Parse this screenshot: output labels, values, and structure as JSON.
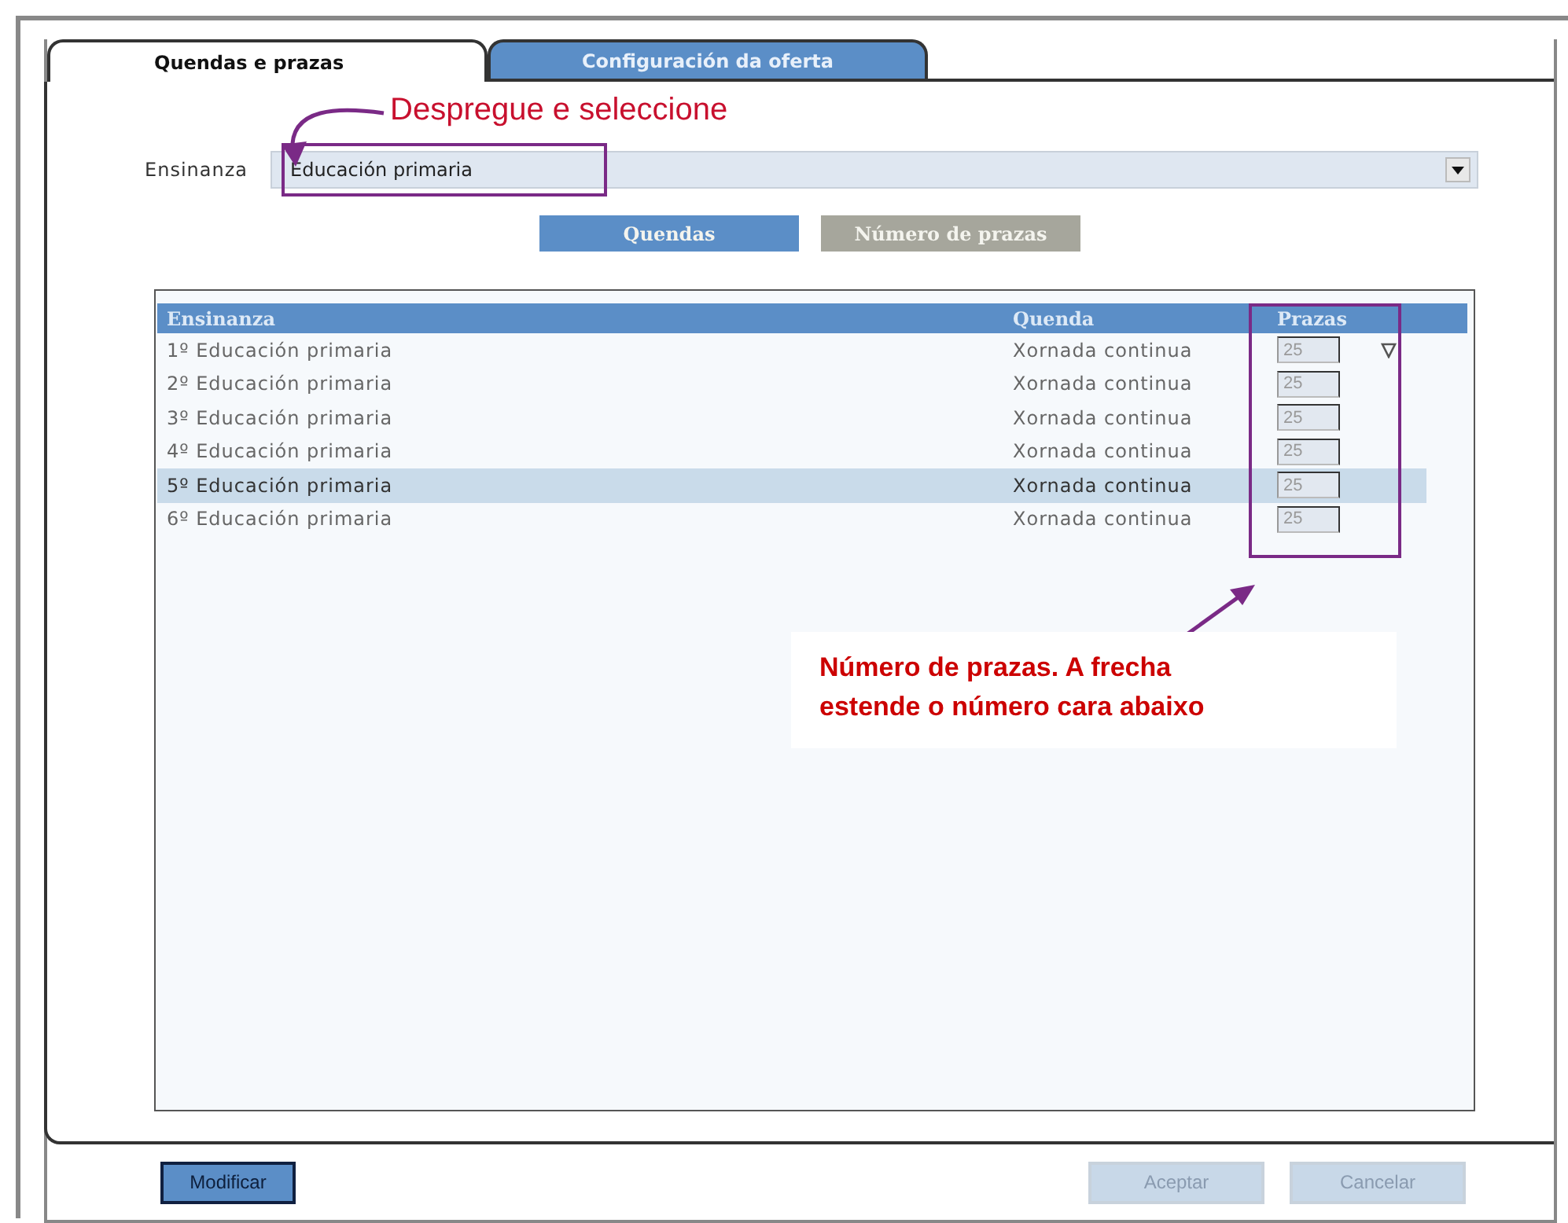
{
  "tabs": [
    {
      "label": "Quendas e prazas",
      "selected": true
    },
    {
      "label": "Configuración da oferta",
      "selected": false
    }
  ],
  "ensinanza": {
    "label": "Ensinanza",
    "value": "Educación primaria"
  },
  "view_buttons": [
    {
      "label": "Quendas",
      "selected": true
    },
    {
      "label": "Número de prazas",
      "selected": false
    }
  ],
  "table": {
    "columns": [
      "Ensinanza",
      "Quenda",
      "Prazas"
    ],
    "rows": [
      {
        "ensinanza": "1º Educación primaria",
        "quenda": "Xornada continua",
        "prazas": "25",
        "selected": false,
        "fill_down": true
      },
      {
        "ensinanza": "2º Educación primaria",
        "quenda": "Xornada continua",
        "prazas": "25",
        "selected": false,
        "fill_down": false
      },
      {
        "ensinanza": "3º Educación primaria",
        "quenda": "Xornada continua",
        "prazas": "25",
        "selected": false,
        "fill_down": false
      },
      {
        "ensinanza": "4º Educación primaria",
        "quenda": "Xornada continua",
        "prazas": "25",
        "selected": false,
        "fill_down": false
      },
      {
        "ensinanza": "5º Educación primaria",
        "quenda": "Xornada continua",
        "prazas": "25",
        "selected": true,
        "fill_down": false
      },
      {
        "ensinanza": "6º Educación primaria",
        "quenda": "Xornada continua",
        "prazas": "25",
        "selected": false,
        "fill_down": false
      }
    ]
  },
  "buttons": [
    {
      "label": "Modificar",
      "disabled": false
    },
    {
      "label": "Aceptar",
      "disabled": true
    },
    {
      "label": "Cancelar",
      "disabled": true
    }
  ],
  "annotations": {
    "select_hint": "Despregue e seleccione",
    "prazas_hint": "Número de prazas. A frecha estende o número cara abaixo"
  }
}
